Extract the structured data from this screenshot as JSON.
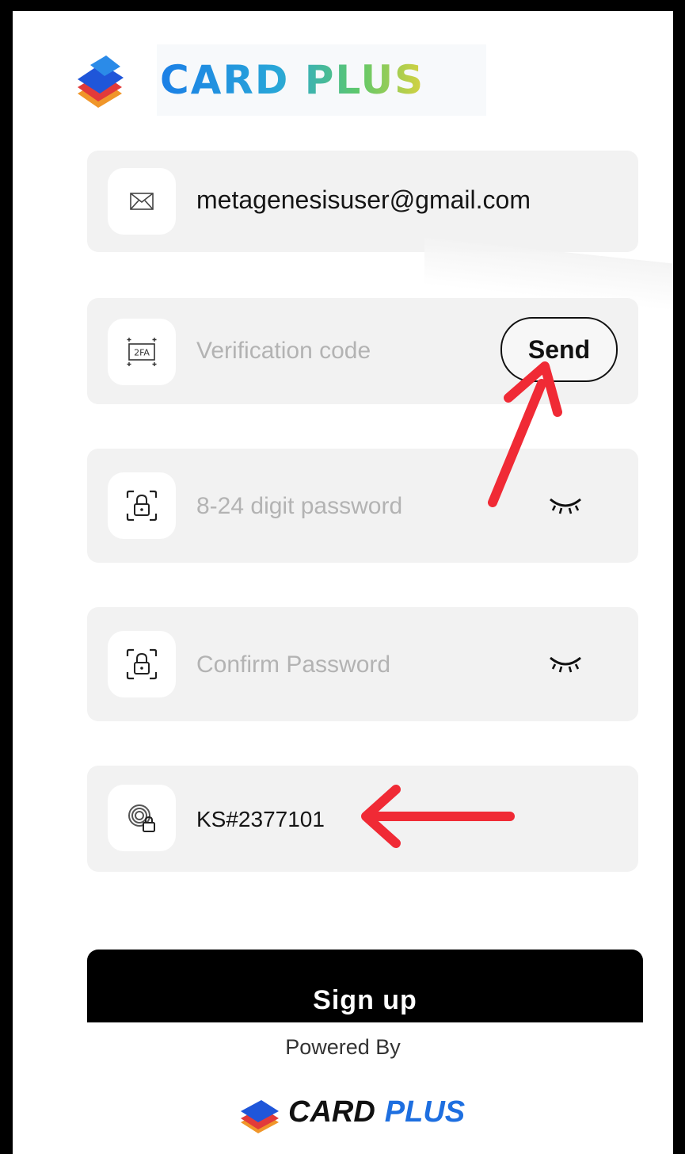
{
  "brand": {
    "name": "CARD PLUS",
    "name_part1": "CARD",
    "name_part2": "PLUS"
  },
  "form": {
    "email": {
      "value": "metagenesisuser@gmail.com",
      "icon": "mail-icon"
    },
    "verification": {
      "placeholder": "Verification code",
      "icon": "2fa-icon",
      "send_label": "Send"
    },
    "password": {
      "placeholder": "8-24 digit password",
      "icon": "lock-icon",
      "toggle_icon": "eye-closed-icon"
    },
    "confirm_password": {
      "placeholder": "Confirm Password",
      "icon": "lock-icon",
      "toggle_icon": "eye-closed-icon"
    },
    "invite": {
      "value": "KS#2377101",
      "icon": "fingerprint-lock-icon"
    }
  },
  "signup_label": "Sign up",
  "footer": {
    "powered_by": "Powered By"
  },
  "colors": {
    "annotation_arrow": "#f02a35",
    "button_bg": "#000000",
    "field_bg": "#f2f2f2"
  }
}
